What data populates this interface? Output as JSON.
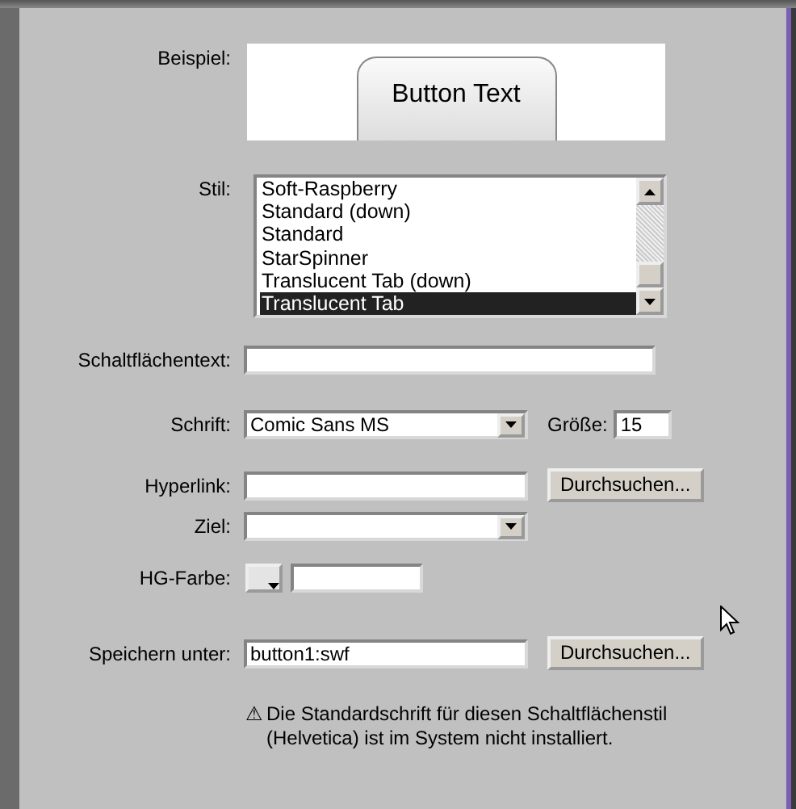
{
  "preview": {
    "label": "Beispiel:",
    "button_text": "Button Text"
  },
  "style": {
    "label": "Stil:",
    "items": [
      {
        "text": "Soft-Raspberry",
        "selected": false
      },
      {
        "text": "Standard (down)",
        "selected": false
      },
      {
        "text": "Standard",
        "selected": false
      },
      {
        "text": "StarSpinner",
        "selected": false
      },
      {
        "text": "Translucent Tab (down)",
        "selected": false
      },
      {
        "text": "Translucent Tab",
        "selected": true
      }
    ]
  },
  "button_text": {
    "label": "Schaltflächentext:"
  },
  "font": {
    "label": "Schrift:",
    "value": "Comic Sans MS"
  },
  "size": {
    "label": "Größe:",
    "value": "15"
  },
  "hyperlink": {
    "label": "Hyperlink:",
    "button": "Durchsuchen..."
  },
  "target": {
    "label": "Ziel:"
  },
  "bg_color": {
    "label": "HG-Farbe:"
  },
  "save_as": {
    "label": "Speichern unter:",
    "value": "button1:swf",
    "button": "Durchsuchen..."
  },
  "warning": {
    "icon": "⚠",
    "text": "Die Standardschrift für diesen Schaltflächenstil (Helvetica) ist im System nicht installiert."
  }
}
